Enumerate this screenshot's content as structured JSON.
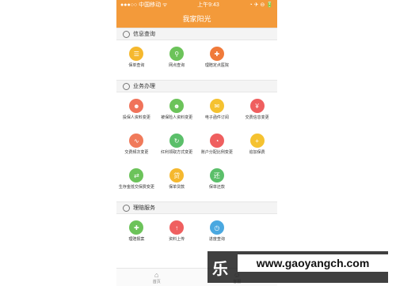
{
  "status": {
    "carrier": "●●●○○ 中国移动 ᯤ",
    "time": "上午9:43",
    "right": "◔ ✈ ⊖ 🔋"
  },
  "header": {
    "title": "我家阳光"
  },
  "sections": [
    {
      "title": "信息查询",
      "icon": "search-icon",
      "items": [
        {
          "label": "保单查询",
          "icon": "list-icon",
          "color": "#f5b82e",
          "glyph": "☰"
        },
        {
          "label": "网点查询",
          "icon": "location-pin-icon",
          "color": "#6cc35a",
          "glyph": "⚲"
        },
        {
          "label": "理赔定点医院",
          "icon": "hospital-cross-icon",
          "color": "#f07a3a",
          "glyph": "✚"
        }
      ]
    },
    {
      "title": "业务办理",
      "icon": "briefcase-icon",
      "items": [
        {
          "label": "投保人资料变更",
          "icon": "user-icon",
          "color": "#f0735a",
          "glyph": "☻"
        },
        {
          "label": "被保险人资料变更",
          "icon": "user-icon",
          "color": "#6cc35a",
          "glyph": "☻"
        },
        {
          "label": "电子函件订阅",
          "icon": "mail-icon",
          "color": "#f5c230",
          "glyph": "✉"
        },
        {
          "label": "交费信息变更",
          "icon": "yen-icon",
          "color": "#ef5f5f",
          "glyph": "¥"
        },
        {
          "label": "交费频次变更",
          "icon": "trend-icon",
          "color": "#f07a5a",
          "glyph": "∿"
        },
        {
          "label": "红利领取方式变更",
          "icon": "refresh-icon",
          "color": "#5bbf6a",
          "glyph": "↻"
        },
        {
          "label": "账户分配比例变更",
          "icon": "gauge-icon",
          "color": "#ef5f5f",
          "glyph": "◔"
        },
        {
          "label": "追加保费",
          "icon": "plus-icon",
          "color": "#f5c230",
          "glyph": "+"
        },
        {
          "label": "生存金抵交保费变更",
          "icon": "exchange-icon",
          "color": "#6cc35a",
          "glyph": "⇄"
        },
        {
          "label": "保单贷款",
          "icon": "loan-icon",
          "color": "#f5b82e",
          "glyph": "贷"
        },
        {
          "label": "保单还款",
          "icon": "repay-icon",
          "color": "#5bbf6a",
          "glyph": "还"
        }
      ]
    },
    {
      "title": "理赔服务",
      "icon": "check-circle-icon",
      "items": [
        {
          "label": "理赔报案",
          "icon": "shield-plus-icon",
          "color": "#6cc35a",
          "glyph": "✚"
        },
        {
          "label": "资料上传",
          "icon": "upload-icon",
          "color": "#ef5f5f",
          "glyph": "↑"
        },
        {
          "label": "进度查询",
          "icon": "clock-icon",
          "color": "#4aa8e0",
          "glyph": "◷"
        }
      ]
    }
  ],
  "tabbar": [
    {
      "label": "首页",
      "icon": "home-icon",
      "glyph": "⌂"
    },
    {
      "label": "客服",
      "icon": "service-icon",
      "glyph": "☺"
    }
  ],
  "watermark": {
    "logo": "乐",
    "url": "www.gaoyangch.com"
  }
}
